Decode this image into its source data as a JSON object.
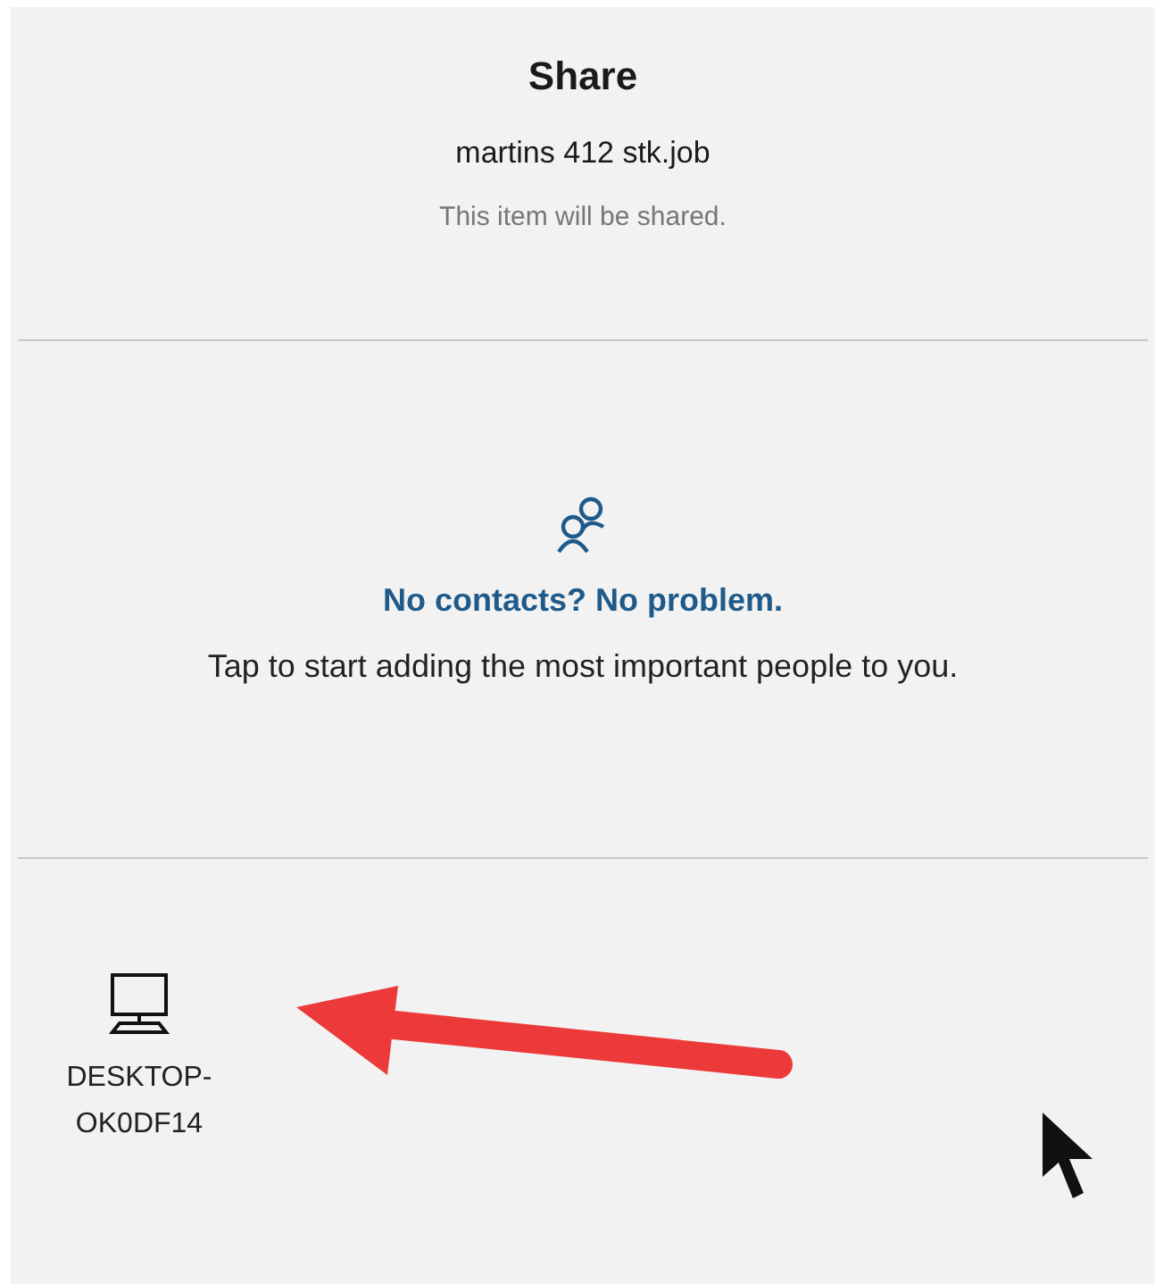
{
  "header": {
    "title": "Share",
    "item_name": "martins 412 stk.job",
    "subtitle": "This item will be shared."
  },
  "contacts": {
    "heading": "No contacts? No problem.",
    "message": "Tap to start adding the most important people to you."
  },
  "devices": [
    {
      "kind": "desktop",
      "name": "DESKTOP-OK0DF14"
    }
  ]
}
